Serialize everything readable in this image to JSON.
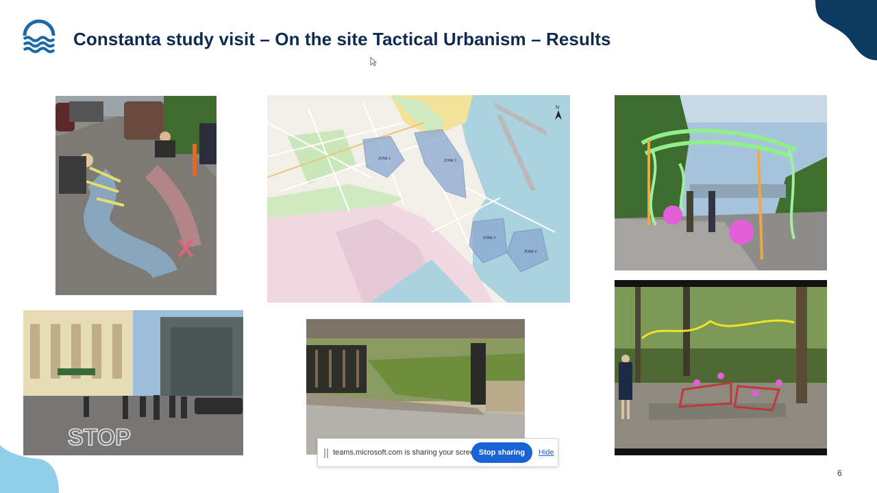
{
  "slide": {
    "title": "Constanta study visit – On the site Tactical Urbanism – Results",
    "page_number": "6"
  },
  "logo": {
    "icon": "waves-logo-icon",
    "color": "#1b6aa8"
  },
  "map": {
    "zones": [
      "ZONE 1",
      "ZONE 2",
      "ZONE 3",
      "ZONE 4"
    ],
    "north_label": "N"
  },
  "sharing_bar": {
    "message": "teams.microsoft.com is sharing your screen.",
    "stop_label": "Stop sharing",
    "hide_label": "Hide"
  },
  "colors": {
    "title": "#0d2a4f",
    "brand_dark": "#0d3a61",
    "brand_light": "#7bc4e0",
    "button": "#1a63d6"
  }
}
